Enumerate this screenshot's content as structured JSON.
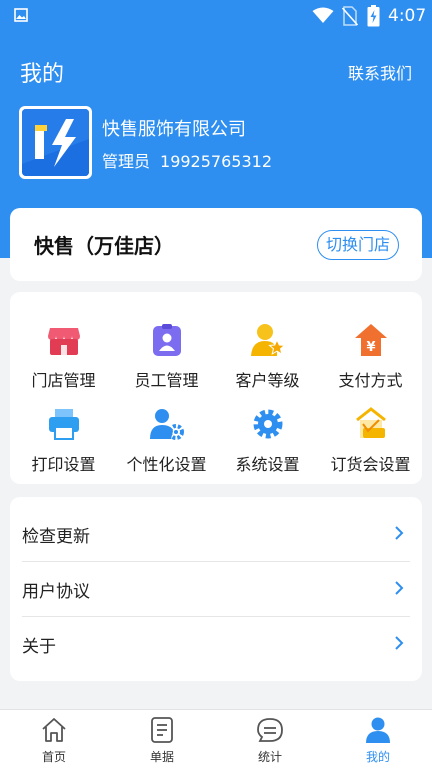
{
  "status_bar": {
    "time": "4:07"
  },
  "header": {
    "title": "我的",
    "contact_label": "联系我们"
  },
  "profile": {
    "company": "快售服饰有限公司",
    "role": "管理员",
    "phone": "19925765312"
  },
  "store": {
    "name": "快售（万佳店）",
    "switch_label": "切换门店"
  },
  "menu": {
    "items": [
      {
        "label": "门店管理",
        "icon": "store-icon",
        "color": "#e8415a"
      },
      {
        "label": "员工管理",
        "icon": "employee-badge-icon",
        "color": "#7b6cf0"
      },
      {
        "label": "客户等级",
        "icon": "customer-level-icon",
        "color": "#f5b400"
      },
      {
        "label": "支付方式",
        "icon": "payment-icon",
        "color": "#f07030"
      },
      {
        "label": "打印设置",
        "icon": "printer-icon",
        "color": "#2e9ff0"
      },
      {
        "label": "个性化设置",
        "icon": "personalize-icon",
        "color": "#2e8ff0"
      },
      {
        "label": "系统设置",
        "icon": "gear-icon",
        "color": "#2e8ff0"
      },
      {
        "label": "订货会设置",
        "icon": "order-fair-icon",
        "color": "#f5b400"
      }
    ]
  },
  "list": {
    "items": [
      {
        "label": "检查更新"
      },
      {
        "label": "用户协议"
      },
      {
        "label": "关于"
      }
    ]
  },
  "tabbar": {
    "items": [
      {
        "label": "首页",
        "icon": "home-icon"
      },
      {
        "label": "单据",
        "icon": "document-icon"
      },
      {
        "label": "统计",
        "icon": "stats-icon"
      },
      {
        "label": "我的",
        "icon": "profile-icon",
        "active": true
      }
    ]
  },
  "colors": {
    "primary": "#2e8ff0",
    "background": "#f2f3f5"
  }
}
